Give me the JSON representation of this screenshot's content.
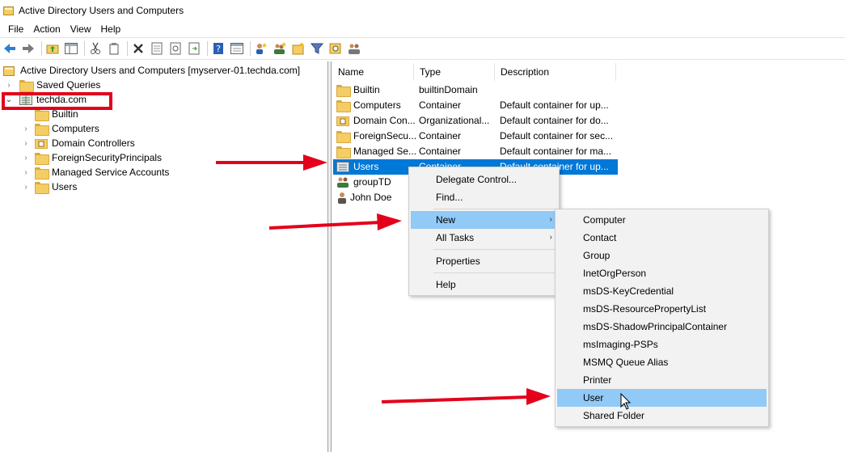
{
  "window": {
    "title": "Active Directory Users and Computers"
  },
  "menubar": [
    "File",
    "Action",
    "View",
    "Help"
  ],
  "tree": {
    "root_label": "Active Directory Users and Computers [myserver-01.techda.com]",
    "items": [
      {
        "label": "Saved Queries",
        "expanded": false
      },
      {
        "label": "techda.com",
        "expanded": true
      },
      {
        "label": "Builtin"
      },
      {
        "label": "Computers"
      },
      {
        "label": "Domain Controllers"
      },
      {
        "label": "ForeignSecurityPrincipals"
      },
      {
        "label": "Managed Service Accounts"
      },
      {
        "label": "Users"
      }
    ]
  },
  "list": {
    "columns": [
      "Name",
      "Type",
      "Description"
    ],
    "rows": [
      {
        "name": "Builtin",
        "type": "builtinDomain",
        "description": ""
      },
      {
        "name": "Computers",
        "type": "Container",
        "description": "Default container for up..."
      },
      {
        "name": "Domain Con...",
        "type": "Organizational...",
        "description": "Default container for do..."
      },
      {
        "name": "ForeignSecu...",
        "type": "Container",
        "description": "Default container for sec..."
      },
      {
        "name": "Managed Se...",
        "type": "Container",
        "description": "Default container for ma..."
      },
      {
        "name": "Users",
        "type": "Container",
        "description": "Default container for up..."
      },
      {
        "name": "groupTD",
        "type": "",
        "description": ""
      },
      {
        "name": "John Doe",
        "type": "",
        "description": ""
      }
    ],
    "selected_index": 5
  },
  "context_menu": {
    "items": [
      "Delegate Control...",
      "Find...",
      "New",
      "All Tasks",
      "Properties",
      "Help"
    ],
    "highlighted": "New"
  },
  "submenu": {
    "items": [
      "Computer",
      "Contact",
      "Group",
      "InetOrgPerson",
      "msDS-KeyCredential",
      "msDS-ResourcePropertyList",
      "msDS-ShadowPrincipalContainer",
      "msImaging-PSPs",
      "MSMQ Queue Alias",
      "Printer",
      "User",
      "Shared Folder"
    ],
    "highlighted": "User"
  },
  "colors": {
    "selection": "#0078d7",
    "menu_highlight": "#91c9f7",
    "annotation_red": "#e3001b",
    "folder": "#f4cd64"
  }
}
